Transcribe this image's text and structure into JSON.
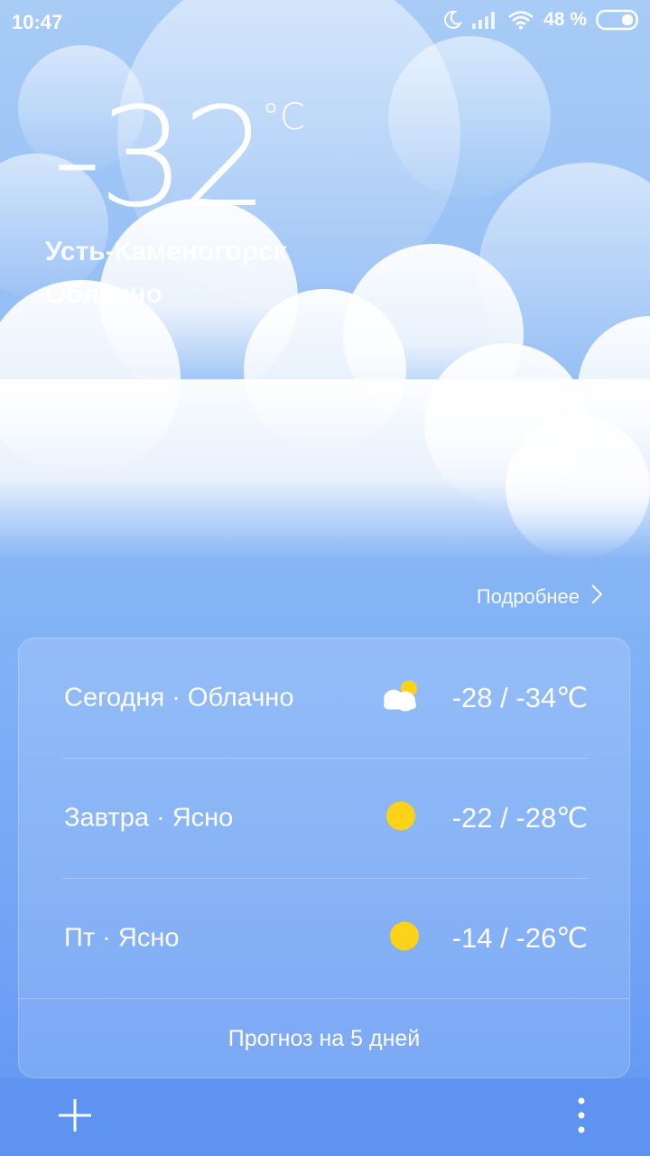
{
  "status_bar": {
    "time": "10:47",
    "battery_percent": "48 %",
    "icons": [
      "moon-icon",
      "signal-icon",
      "wifi-icon",
      "battery-icon"
    ]
  },
  "current": {
    "temperature": "-32",
    "unit": "°C",
    "city": "Усть-Каменогорск",
    "condition": "Облачно"
  },
  "details_link": {
    "label": "Подробнее",
    "icon": "chevron-right-icon"
  },
  "forecast": [
    {
      "label": "Сегодня · Облачно",
      "icon": "partly-cloudy-icon",
      "range": "-28 / -34℃"
    },
    {
      "label": "Завтра · Ясно",
      "icon": "sun-icon",
      "range": "-22 / -28℃"
    },
    {
      "label": "Пт · Ясно",
      "icon": "sun-icon",
      "range": "-14 / -26℃"
    }
  ],
  "five_day_button": "Прогноз на 5 дней",
  "bottom_bar": {
    "add_icon": "plus-icon",
    "menu_icon": "more-vertical-icon"
  },
  "colors": {
    "sun": "#ffd21a",
    "bottom_bar": "#5e93f2",
    "sky_top": "#a8ccf6",
    "sky_bottom": "#5f95f3"
  }
}
